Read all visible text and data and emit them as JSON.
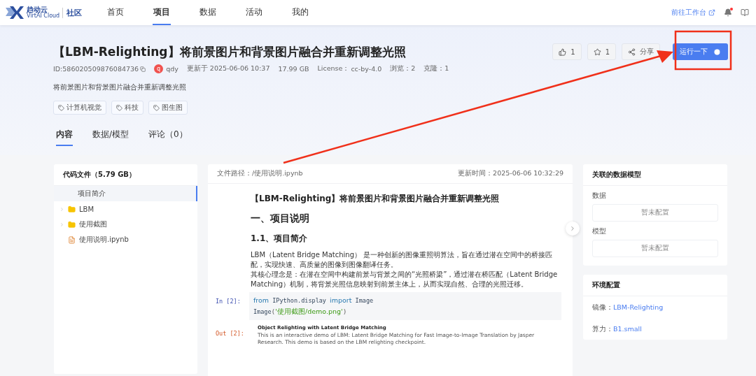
{
  "header": {
    "logo_name": "趋动云",
    "logo_sub": "VirtAI Cloud",
    "community": "社区",
    "nav": [
      {
        "label": "首页",
        "selected": false
      },
      {
        "label": "项目",
        "selected": true
      },
      {
        "label": "数据",
        "selected": false
      },
      {
        "label": "活动",
        "selected": false
      },
      {
        "label": "我的",
        "selected": false
      }
    ],
    "workbench_link": "前往工作台",
    "has_notification": true
  },
  "project": {
    "title": "【LBM-Relighting】将前景图片和背景图片融合并重新调整光照",
    "id": "ID:586020509876084736",
    "author_initial": "q",
    "author": "qdy",
    "updated": "更新于 2025-06-06 10:37",
    "size": "17.99 GB",
    "license_label": "License：",
    "license": "cc-by-4.0",
    "views": "浏览：2",
    "clones": "克隆：1",
    "description": "将前景图片和背景图片融合并重新调整光照",
    "tags": [
      "计算机视觉",
      "科技",
      "图生图"
    ],
    "likes": "1",
    "stars": "1",
    "share": "分享",
    "run": "运行一下"
  },
  "tabs": [
    {
      "label": "内容",
      "selected": true
    },
    {
      "label": "数据/模型",
      "selected": false
    },
    {
      "label": "评论（0）",
      "selected": false
    }
  ],
  "files": {
    "title": "代码文件（5.79 GB）",
    "items": [
      {
        "kind": "page",
        "name": "项目简介",
        "selected": true
      },
      {
        "kind": "folder",
        "name": "LBM",
        "selected": false
      },
      {
        "kind": "folder",
        "name": "使用截图",
        "selected": false
      },
      {
        "kind": "notebook",
        "name": "使用说明.ipynb",
        "selected": false
      }
    ]
  },
  "viewer": {
    "path": "文件路径：/使用说明.ipynb",
    "updated": "更新时间：2025-06-06 10:32:29",
    "doc_title": "【LBM-Relighting】将前景图片和背景图片融合并重新调整光照",
    "h1": "一、项目说明",
    "h2": "1.1、项目简介",
    "paragraphs": [
      "LBM（Latent Bridge Matching） 是一种创新的图像重照明算法，旨在通过潜在空间中的桥接匹配，实现快速、高质量的图像到图像翻译任务。",
      "其核心理念是：在潜在空间中构建前景与背景之间的“光照桥梁”，通过潜在桥匹配（Latent Bridge Matching）机制，将背景光照信息映射到前景主体上，从而实现自然、合理的光照迁移。"
    ],
    "in_prompt": "In [2]:",
    "code": [
      [
        {
          "kind": "keyword",
          "text": "from"
        },
        {
          "kind": "name",
          "text": " IPython.display "
        },
        {
          "kind": "keyword",
          "text": "import"
        },
        {
          "kind": "name",
          "text": " Image"
        }
      ],
      [
        {
          "kind": "name",
          "text": "Image"
        },
        {
          "kind": "punct",
          "text": "("
        },
        {
          "kind": "string",
          "text": "'使用截图/demo.png'"
        },
        {
          "kind": "punct",
          "text": ")"
        }
      ]
    ],
    "out_prompt": "Out [2]:",
    "output_title": "Object Relighting with Latent Bridge Matching",
    "output_text": "This is an interactive demo of LBM: Latent Bridge Matching for Fast Image-to-Image Translation by Jasper Research. This demo is based on the LBM relighting checkpoint."
  },
  "related": {
    "title": "关联的数据模型",
    "sections": [
      {
        "label": "数据",
        "value": "暂未配置"
      },
      {
        "label": "模型",
        "value": "暂未配置"
      }
    ]
  },
  "environment": {
    "title": "环境配置",
    "rows": [
      {
        "label": "镜像：",
        "value": "LBM-Relighting"
      },
      {
        "label": "算力：",
        "value": "B1.small"
      }
    ]
  }
}
